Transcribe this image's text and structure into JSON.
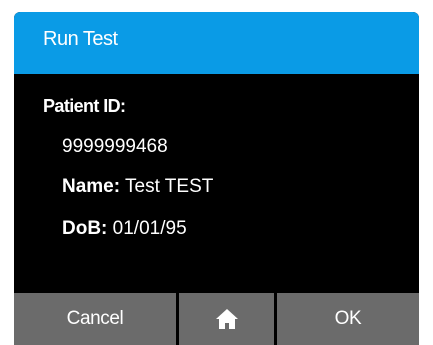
{
  "titlebar": {
    "title": "Run Test"
  },
  "patient": {
    "id_label": "Patient ID:",
    "id_value": "9999999468",
    "name_label": "Name:",
    "name_value": "Test TEST",
    "dob_label": "DoB:",
    "dob_value": "01/01/95"
  },
  "buttons": {
    "cancel_label": "Cancel",
    "home_icon": "home-icon",
    "ok_label": "OK"
  },
  "colors": {
    "titlebar": "#0a9be6",
    "background": "#000000",
    "button": "#6b6b6b",
    "text": "#ffffff"
  }
}
